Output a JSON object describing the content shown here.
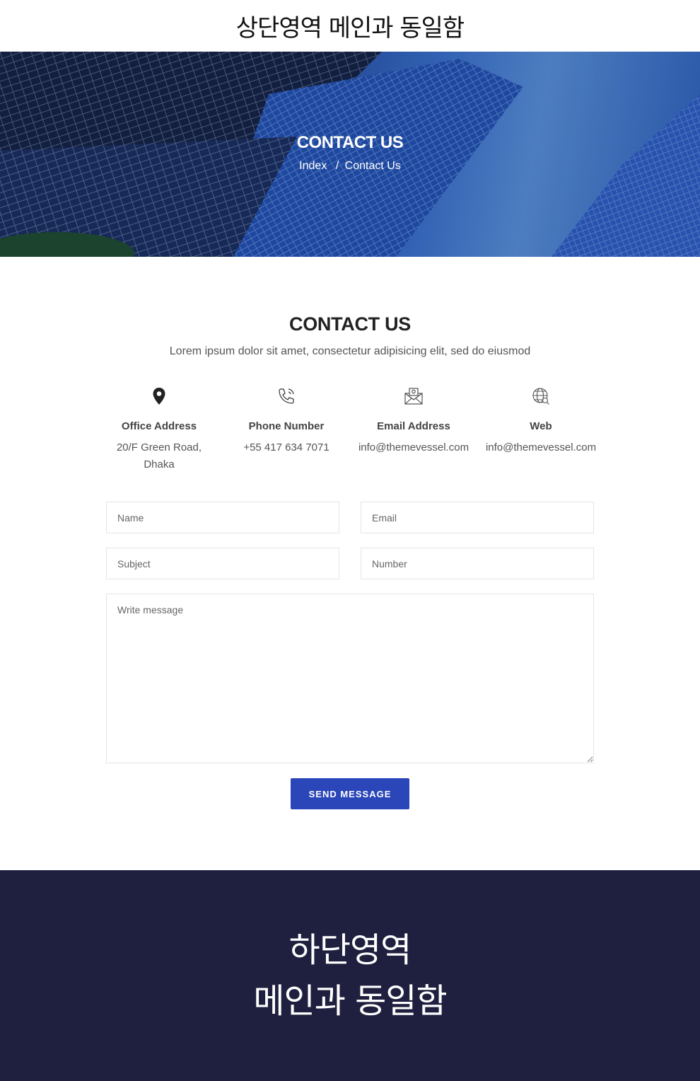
{
  "header": {
    "placeholder_text": "상단영역 메인과 동일함"
  },
  "hero": {
    "title": "CONTACT US",
    "breadcrumb": {
      "home": "Index",
      "separator": "/",
      "current": "Contact Us"
    }
  },
  "contact": {
    "title": "CONTACT US",
    "subtitle": "Lorem ipsum dolor sit amet, consectetur adipisicing elit, sed do eiusmod",
    "items": [
      {
        "icon": "location-pin-icon",
        "label": "Office Address",
        "value_line1": "20/F Green Road,",
        "value_line2": "Dhaka"
      },
      {
        "icon": "phone-icon",
        "label": "Phone Number",
        "value_line1": "+55 417 634 7071",
        "value_line2": ""
      },
      {
        "icon": "envelope-icon",
        "label": "Email Address",
        "value_line1": "info@themevessel.com",
        "value_line2": ""
      },
      {
        "icon": "globe-icon",
        "label": "Web",
        "value_line1": "info@themevessel.com",
        "value_line2": ""
      }
    ]
  },
  "form": {
    "name_placeholder": "Name",
    "email_placeholder": "Email",
    "subject_placeholder": "Subject",
    "number_placeholder": "Number",
    "message_placeholder": "Write message",
    "submit_label": "SEND MESSAGE"
  },
  "footer": {
    "line1": "하단영역",
    "line2": "메인과 동일함"
  },
  "colors": {
    "accent": "#2a46b8",
    "footer_bg": "#1f1f3f",
    "hero_blue": "#3a6ec8"
  }
}
